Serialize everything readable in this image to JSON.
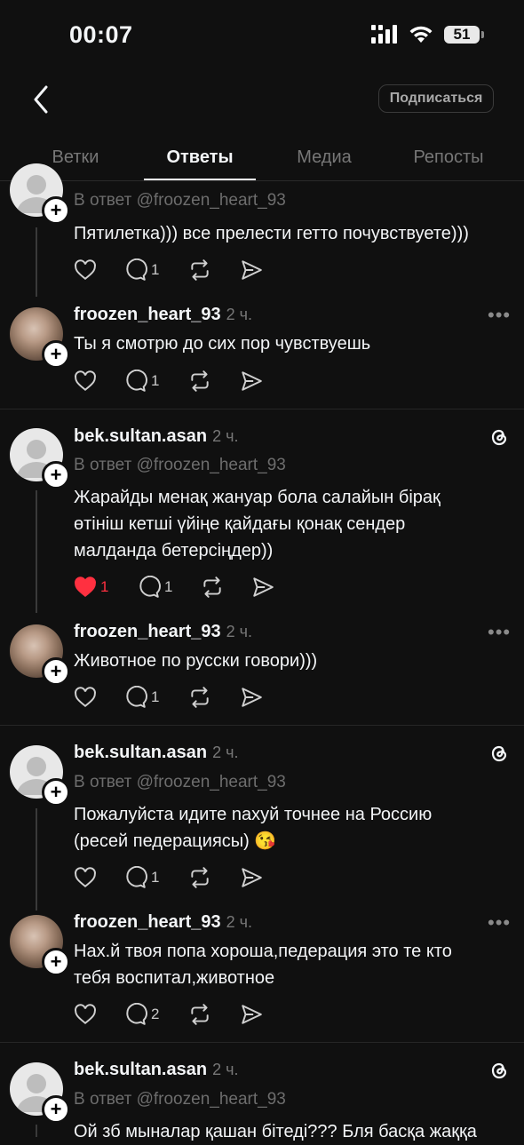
{
  "status_bar": {
    "time": "00:07",
    "battery": "51"
  },
  "header": {
    "subscribe_label": "Подписаться"
  },
  "tabs": [
    {
      "label": "Ветки"
    },
    {
      "label": "Ответы"
    },
    {
      "label": "Медиа"
    },
    {
      "label": "Репосты"
    }
  ],
  "posts": [
    {
      "reply_to": "В ответ @froozen_heart_93",
      "text": "Пятилетка))) все прелести гетто почувствуете)))",
      "reply_count": "1"
    },
    {
      "username": "froozen_heart_93",
      "time": "2 ч.",
      "text": "Ты я смотрю до сих пор чувствуешь",
      "reply_count": "1"
    },
    {
      "username": "bek.sultan.asan",
      "time": "2 ч.",
      "reply_to": "В ответ @froozen_heart_93",
      "text_lines": [
        "Жарайды менақ жануар бола салайын бірақ",
        "өтініш кетші үйіңе қайдағы қонақ сендер",
        "малданда бетерсіңдер))"
      ],
      "like_count": "1",
      "reply_count": "1"
    },
    {
      "username": "froozen_heart_93",
      "time": "2 ч.",
      "text": "Животное по русски говори)))",
      "reply_count": "1"
    },
    {
      "username": "bek.sultan.asan",
      "time": "2 ч.",
      "reply_to": "В ответ @froozen_heart_93",
      "text_lines": [
        "Пожалуйста идите nахуй точнее на Россию",
        "(ресей педерациясы) 😘"
      ],
      "reply_count": "1"
    },
    {
      "username": "froozen_heart_93",
      "time": "2 ч.",
      "text_lines": [
        "Нах.й твоя попа хороша,педерация это те кто",
        "тебя воспитал,животное"
      ],
      "reply_count": "2"
    },
    {
      "username": "bek.sultan.asan",
      "time": "2 ч.",
      "reply_to": "В ответ @froozen_heart_93",
      "text": "Ой зб мыналар қашан бітеді??? Бля басқа жаққа"
    }
  ],
  "colors": {
    "background": "#101010",
    "text": "#f3f5f7",
    "muted": "#777777",
    "like": "#ff3040"
  }
}
